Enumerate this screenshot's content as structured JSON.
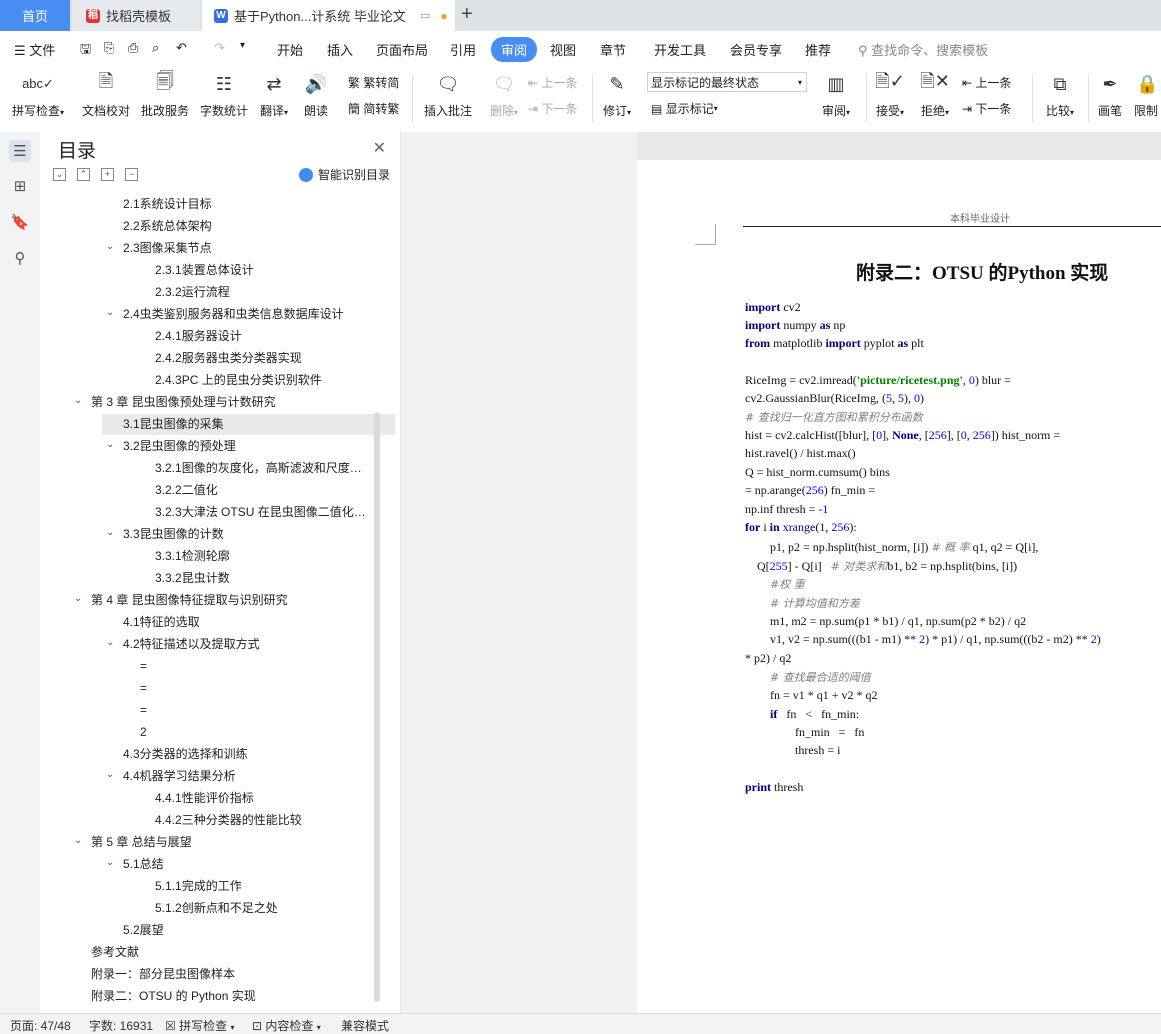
{
  "tabs": {
    "home": "首页",
    "templates": "找稻壳模板",
    "document": "基于Python...计系统 毕业论文"
  },
  "menu": {
    "file": "文件",
    "items": [
      "开始",
      "插入",
      "页面布局",
      "引用",
      "审阅",
      "视图",
      "章节",
      "开发工具",
      "会员专享",
      "推荐"
    ],
    "search_placeholder": "查找命令、搜索模板"
  },
  "ribbon": {
    "spell_check": "拼写检查",
    "doc_proof": "文档校对",
    "batch_service": "批改服务",
    "word_count": "字数统计",
    "translate": "翻译",
    "read_aloud": "朗读",
    "to_traditional": "繁转简",
    "to_simplified": "简转繁",
    "insert_comment": "插入批注",
    "delete": "删除",
    "prev": "上一条",
    "next": "下一条",
    "revise": "修订",
    "display_state": "显示标记的最终状态",
    "show_markup": "显示标记",
    "review": "审阅",
    "accept": "接受",
    "reject": "拒绝",
    "prev2": "上一条",
    "next2": "下一条",
    "compare": "比较",
    "pen": "画笔",
    "restrict": "限制"
  },
  "toc": {
    "title": "目录",
    "smart": "智能识别目录",
    "items": [
      {
        "text": "2.1系统设计目标",
        "level": 2
      },
      {
        "text": "2.2系统总体架构",
        "level": 2
      },
      {
        "text": "2.3图像采集节点",
        "level": 2,
        "caret": true
      },
      {
        "text": "2.3.1装置总体设计",
        "level": 3
      },
      {
        "text": "2.3.2运行流程",
        "level": 3
      },
      {
        "text": "2.4虫类鉴别服务器和虫类信息数据库设计",
        "level": 2,
        "caret": true
      },
      {
        "text": "2.4.1服务器设计",
        "level": 3
      },
      {
        "text": "2.4.2服务器虫类分类器实现",
        "level": 3
      },
      {
        "text": "2.4.3PC 上的昆虫分类识别软件",
        "level": 3
      },
      {
        "text": "第 3 章 昆虫图像预处理与计数研究",
        "level": 1,
        "caret": true
      },
      {
        "text": "3.1昆虫图像的采集",
        "level": 2,
        "selected": true
      },
      {
        "text": "3.2昆虫图像的预处理",
        "level": 2,
        "caret": true
      },
      {
        "text": "3.2.1图像的灰度化，高斯滤波和尺度…",
        "level": 3
      },
      {
        "text": "3.2.2二值化",
        "level": 3
      },
      {
        "text": "3.2.3大津法 OTSU 在昆虫图像二值化…",
        "level": 3
      },
      {
        "text": "3.3昆虫图像的计数",
        "level": 2,
        "caret": true
      },
      {
        "text": "3.3.1检测轮廓",
        "level": 3
      },
      {
        "text": "3.3.2昆虫计数",
        "level": 3
      },
      {
        "text": "第 4 章 昆虫图像特征提取与识别研究",
        "level": 1,
        "caret": true
      },
      {
        "text": "4.1特征的选取",
        "level": 2
      },
      {
        "text": "4.2特征描述以及提取方式",
        "level": 2,
        "caret": true
      },
      {
        "text": "=",
        "level": 2.5
      },
      {
        "text": "=",
        "level": 2.5
      },
      {
        "text": "=",
        "level": 2.5
      },
      {
        "text": "2",
        "level": 2.5
      },
      {
        "text": "4.3分类器的选择和训练",
        "level": 2
      },
      {
        "text": "4.4机器学习结果分析",
        "level": 2,
        "caret": true
      },
      {
        "text": "4.4.1性能评价指标",
        "level": 3
      },
      {
        "text": "4.4.2三种分类器的性能比较",
        "level": 3
      },
      {
        "text": "第 5 章 总结与展望",
        "level": 1,
        "caret": true
      },
      {
        "text": "5.1总结",
        "level": 2,
        "caret": true
      },
      {
        "text": "5.1.1完成的工作",
        "level": 3
      },
      {
        "text": "5.1.2创新点和不足之处",
        "level": 3
      },
      {
        "text": "5.2展望",
        "level": 2
      },
      {
        "text": "参考文献",
        "level": 1
      },
      {
        "text": "附录一：部分昆虫图像样本",
        "level": 1
      },
      {
        "text": "附录二：OTSU 的 Python 实现",
        "level": 1
      }
    ]
  },
  "page": {
    "header": "本科毕业设计",
    "title": "附录二：OTSU 的Python 实现"
  },
  "status": {
    "page": "页面: 47/48",
    "words": "字数: 16931",
    "spell": "拼写检查",
    "content": "内容检查",
    "mode": "兼容模式"
  },
  "colors": {
    "accent": "#4a8df2",
    "keyword": "#000080",
    "string": "#008000",
    "number": "#0000ff",
    "comment": "#808080"
  }
}
